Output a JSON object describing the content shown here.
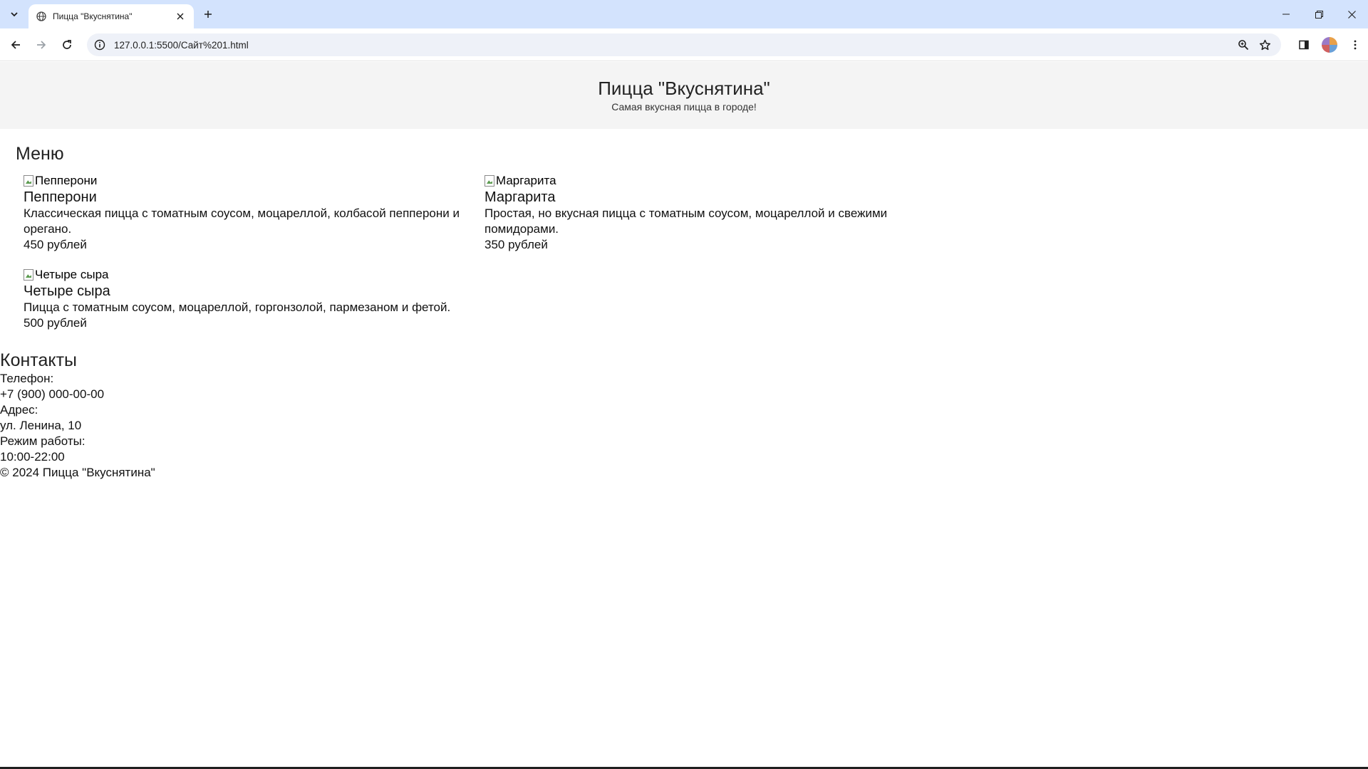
{
  "browser": {
    "tab_title": "Пицца \"Вкуснятина\"",
    "url": "127.0.0.1:5500/Сайт%201.html",
    "icons": {
      "tab_search": "chevron-down-icon",
      "favicon": "globe-icon",
      "tab_close": "close-icon",
      "new_tab": "plus-icon",
      "back": "back-arrow-icon",
      "forward": "forward-arrow-icon",
      "reload": "reload-icon",
      "site_info": "info-icon",
      "zoom": "zoom-icon",
      "bookmark": "star-icon",
      "side_panel": "side-panel-icon",
      "profile": "avatar",
      "menu": "kebab-menu-icon"
    }
  },
  "site": {
    "title": "Пицца \"Вкуснятина\"",
    "tagline": "Самая вкусная пицца в городе!"
  },
  "menu": {
    "heading": "Меню",
    "items": [
      {
        "img_alt": "Пепперони",
        "name": "Пепперони",
        "description": "Классическая пицца с томатным соусом, моцареллой, колбасой пепперони и орегано.",
        "price": "450 рублей"
      },
      {
        "img_alt": "Маргарита",
        "name": "Маргарита",
        "description": "Простая, но вкусная пицца с томатным соусом, моцареллой и свежими помидорами.",
        "price": "350 рублей"
      },
      {
        "img_alt": "Четыре сыра",
        "name": "Четыре сыра",
        "description": "Пицца с томатным соусом, моцареллой, горгонзолой, пармезаном и фетой.",
        "price": "500 рублей"
      }
    ]
  },
  "contacts": {
    "heading": "Контакты",
    "phone_label": "Телефон:",
    "phone": "+7 (900) 000-00-00",
    "address_label": "Адрес:",
    "address": "ул. Ленина, 10",
    "hours_label": "Режим работы:",
    "hours": "10:00-22:00",
    "copyright": "© 2024 Пицца \"Вкуснятина\""
  }
}
